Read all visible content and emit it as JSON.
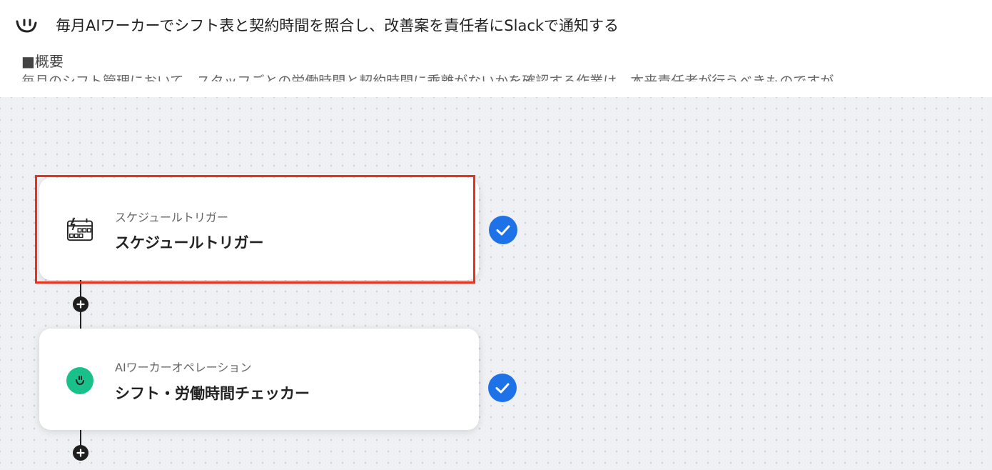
{
  "header": {
    "logo_icon": "yoom-smile-logo-icon",
    "title": "毎月AIワーカーでシフト表と契約時間を照合し、改善案を責任者にSlackで通知する",
    "summary_label": "■概要",
    "summary_text": "毎月のシフト管理において、スタッフごとの労働時間と契約時間に乖離がないかを確認する作業は、本来責任者が行うべきものですが"
  },
  "flow": {
    "steps": [
      {
        "subtitle": "スケジュールトリガー",
        "title": "スケジュールトリガー",
        "icon": "calendar-lightning-icon",
        "status": "complete"
      },
      {
        "subtitle": "AIワーカーオペレーション",
        "title": "シフト・労働時間チェッカー",
        "icon": "ai-worker-icon",
        "status": "complete"
      }
    ]
  },
  "colors": {
    "accent_blue": "#1d72e8",
    "highlight_red": "#e8321c",
    "ai_green": "#19c08a",
    "canvas_bg": "#eef0f3"
  }
}
